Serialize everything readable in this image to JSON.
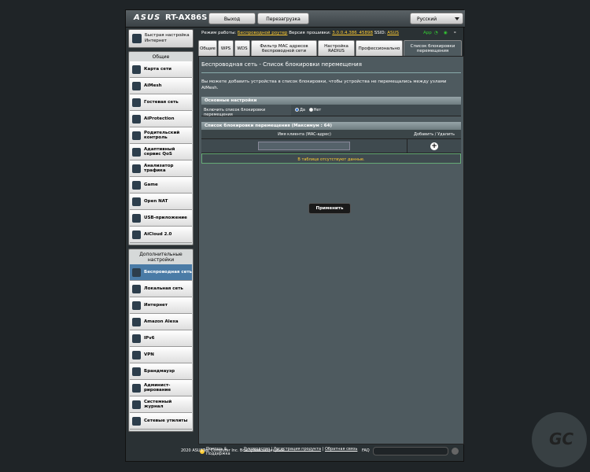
{
  "header": {
    "logo": "ASUS",
    "model": "RT-AX86S",
    "logout_label": "Выход",
    "reboot_label": "Перезагрузка",
    "language": "Русский"
  },
  "status": {
    "mode_label": "Режим работы:",
    "mode_value": "Беспроводной роутер",
    "fw_label": "Версия прошивки:",
    "fw_value": "3.0.0.4.386_45898",
    "ssid_label": "SSID:",
    "ssid_value": "ASUS",
    "app_label": "App"
  },
  "sidebar": {
    "quick": "Быстрая настройка Интернет",
    "general_title": "Общие",
    "general": [
      {
        "label": "Карта сети",
        "icon": "map-icon"
      },
      {
        "label": "AiMesh",
        "icon": "mesh-icon"
      },
      {
        "label": "Гостевая сеть",
        "icon": "guest-icon"
      },
      {
        "label": "AiProtection",
        "icon": "shield-icon"
      },
      {
        "label": "Родительский контроль",
        "icon": "parental-icon"
      },
      {
        "label": "Адаптивный сервис QoS",
        "icon": "qos-icon"
      },
      {
        "label": "Анализатор трафика",
        "icon": "traffic-icon"
      },
      {
        "label": "Game",
        "icon": "game-icon"
      },
      {
        "label": "Open NAT",
        "icon": "nat-icon"
      },
      {
        "label": "USB-приложение",
        "icon": "usb-icon"
      },
      {
        "label": "AiCloud 2.0",
        "icon": "cloud-icon"
      }
    ],
    "advanced_title": "Дополнительные настройки",
    "advanced": [
      {
        "label": "Беспроводная сеть",
        "icon": "wifi-icon"
      },
      {
        "label": "Локальная сеть",
        "icon": "lan-icon"
      },
      {
        "label": "Интернет",
        "icon": "globe-icon"
      },
      {
        "label": "Amazon Alexa",
        "icon": "alexa-icon"
      },
      {
        "label": "IPv6",
        "icon": "ipv6-icon"
      },
      {
        "label": "VPN",
        "icon": "vpn-icon"
      },
      {
        "label": "Брандмауэр",
        "icon": "firewall-icon"
      },
      {
        "label": "Админист-рирование",
        "icon": "admin-icon"
      },
      {
        "label": "Системный журнал",
        "icon": "log-icon"
      },
      {
        "label": "Сетевые утилиты",
        "icon": "tools-icon"
      }
    ]
  },
  "tabs": [
    {
      "label": "Общие"
    },
    {
      "label": "WPS"
    },
    {
      "label": "WDS"
    },
    {
      "label": "Фильтр MAC адресов беспроводной сети"
    },
    {
      "label": "Настройка RADIUS"
    },
    {
      "label": "Профессионально"
    },
    {
      "label": "Список блокировки перемещения"
    }
  ],
  "content": {
    "title": "Беспроводная сеть - Список блокировки перемещения",
    "description": "Вы можете добавить устройства в список блокировки, чтобы устройства не перемещались между узлами AiMesh.",
    "basic_header": "Основные настройки",
    "enable_label": "Включить список блокировки перемещения",
    "yes": "Да",
    "no": "Нет",
    "list_header": "Список блокировки перемещения (Максимум : 64)",
    "col_client": "Имя клиента (MAC-адрес)",
    "col_action": "Добавить / Удалить",
    "empty": "В таблице отсутствуют данные.",
    "apply": "Применить"
  },
  "footer": {
    "help": "Помощь & Поддержка",
    "manual": "Руководство",
    "register": "Регистрация продукта",
    "feedback": "Обратная связь",
    "faq": "FAQ",
    "copyright": "2020 ASUSTeK Computer Inc. Все права защищены."
  }
}
